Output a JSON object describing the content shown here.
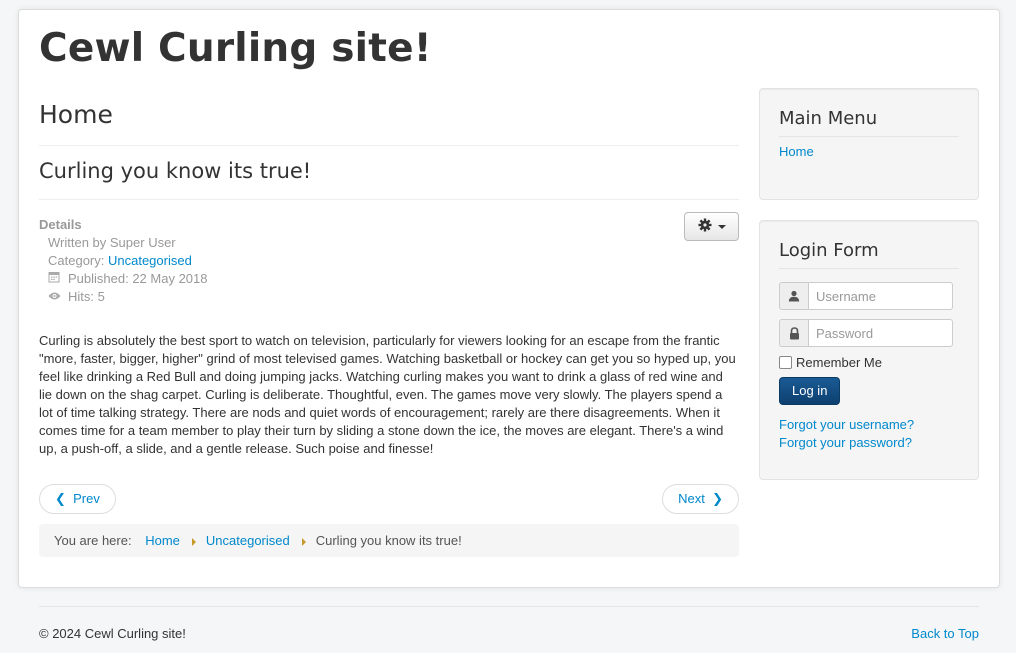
{
  "site": {
    "title": "Cewl Curling site!"
  },
  "page": {
    "heading": "Home"
  },
  "article": {
    "title": "Curling you know its true!",
    "details_label": "Details",
    "written_by": "Written by Super User",
    "category_label": "Category: ",
    "category_value": "Uncategorised",
    "published": "Published: 22 May 2018",
    "hits": "Hits: 5",
    "body": "Curling is absolutely the best sport to watch on television, particularly for viewers looking for an escape from the frantic \"more, faster, bigger, higher\" grind of most televised games. Watching basketball or hockey can get you so hyped up, you feel like drinking a Red Bull and doing jumping jacks. Watching curling makes you want to drink a glass of red wine and lie down on the shag carpet. Curling is deliberate. Thoughtful, even. The games move very slowly. The players spend a lot of time talking strategy. There are nods and quiet words of encouragement; rarely are there disagreements. When it comes time for a team member to play their turn by sliding a stone down the ice, the moves are elegant. There's a wind up, a push-off, a slide, and a gentle release. Such poise and finesse!"
  },
  "pager": {
    "prev": "Prev",
    "next": "Next"
  },
  "breadcrumb": {
    "label": "You are here:",
    "items": [
      "Home",
      "Uncategorised",
      "Curling you know its true!"
    ]
  },
  "sidebar": {
    "main_menu": {
      "title": "Main Menu",
      "items": [
        "Home"
      ]
    },
    "login": {
      "title": "Login Form",
      "username_placeholder": "Username",
      "password_placeholder": "Password",
      "remember_label": "Remember Me",
      "button": "Log in",
      "forgot_username": "Forgot your username?",
      "forgot_password": "Forgot your password?"
    }
  },
  "footer": {
    "copyright": "© 2024 Cewl Curling site!",
    "back_to_top": "Back to Top"
  },
  "icons": {
    "cog": "gear-icon",
    "user": "user-icon",
    "lock": "lock-icon",
    "calendar": "calendar-icon",
    "eye": "eye-icon"
  },
  "colors": {
    "link": "#0088cc",
    "button": "#0d3f6f",
    "breadcrumb_sep": "#c79b2b"
  }
}
